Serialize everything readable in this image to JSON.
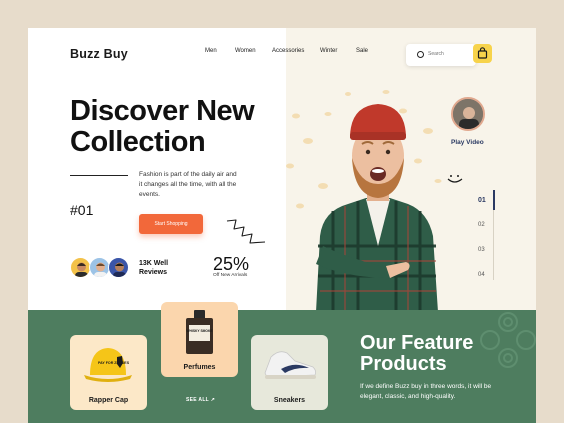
{
  "brand": "Buzz Buy",
  "nav": [
    "Men",
    "Women",
    "Accessories",
    "Winter",
    "Sale"
  ],
  "search": {
    "placeholder": "Search"
  },
  "hero": {
    "headline_line1": "Discover New",
    "headline_line2": "Collection",
    "description": "Fashion is part of the daily air and it changes all the time, with all the events.",
    "slide_number": "#01",
    "cta_label": "Start Shopping",
    "reviews": "13K Well Reviews",
    "offer_percent": "25%",
    "offer_label": "Off New Arrivals"
  },
  "video": {
    "label": "Play Video"
  },
  "steps": [
    "01",
    "02",
    "03",
    "04"
  ],
  "products": [
    {
      "label": "Rapper Cap",
      "cap_text": "PAY FOR ZEROES"
    },
    {
      "label": "Perfumes",
      "bottle_text": "WHISKY SMOKE"
    },
    {
      "label": "Sneakers"
    }
  ],
  "see_all": "SEE ALL ↗",
  "feature": {
    "title_line1": "Our Feature",
    "title_line2": "Products",
    "description": "If we define Buzz buy in three words, it will be elegant, classic, and high-quality."
  },
  "colors": {
    "accent_orange": "#f2683a",
    "accent_yellow": "#f7d34b",
    "green_panel": "#4e7d5f",
    "navy": "#2b3a63",
    "hero_right_bg": "#f8f4ea"
  },
  "icons": [
    "search-icon",
    "shopping-bag-icon",
    "squiggle-arrow-icon",
    "smiley-icon",
    "play-icon",
    "arrow-up-right-icon"
  ]
}
